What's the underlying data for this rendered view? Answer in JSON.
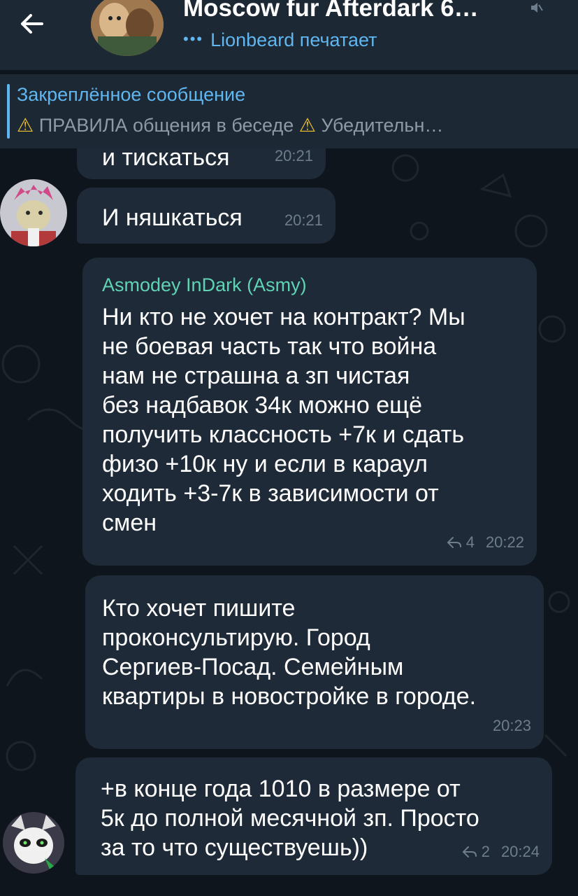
{
  "header": {
    "title": "Moscow fur Afterdark 6…",
    "typing_dots": "•••",
    "typing_text": "Lionbeard печатает"
  },
  "pinned": {
    "title": "Закреплённое сообщение",
    "warn1": "⚠",
    "text_part1": " ПРАВИЛА общения в беседе ",
    "warn2": "⚠",
    "text_part2": " Убедительн…"
  },
  "messages": [
    {
      "text": "и тискаться",
      "time": "20:21"
    },
    {
      "text": "И няшкаться",
      "time": "20:21"
    },
    {
      "sender": "Asmodey InDark (Asmy)",
      "text": "Ни кто не хочет на контракт? Мы\nне боевая часть так что война\nнам не страшна а зп чистая\nбез надбавок 34к можно ещё\nполучить классность +7к и сдать\nфизо +10к ну и если в караул\nходить +3-7к в зависимости от\nсмен",
      "replies": "4",
      "time": "20:22"
    },
    {
      "text": "Кто хочет пишите\nпроконсультирую.  Город\nСергиев-Посад.  Семейным\nквартиры в новостройке в городе.",
      "time": "20:23"
    },
    {
      "text": "+в конце года 1010 в размере от\n5к до полной месячной зп. Просто\nза то что существуешь))",
      "replies": "2",
      "time": "20:24"
    }
  ],
  "colors": {
    "header_bg": "#1c2834",
    "chat_bg": "#0f151c",
    "bubble_bg": "#1e2a37",
    "accent": "#5fb6f0",
    "sender_name": "#5fd3b4",
    "meta": "#6d7d8c"
  },
  "icons": [
    "back-arrow-icon",
    "mute-icon",
    "reply-icon"
  ]
}
